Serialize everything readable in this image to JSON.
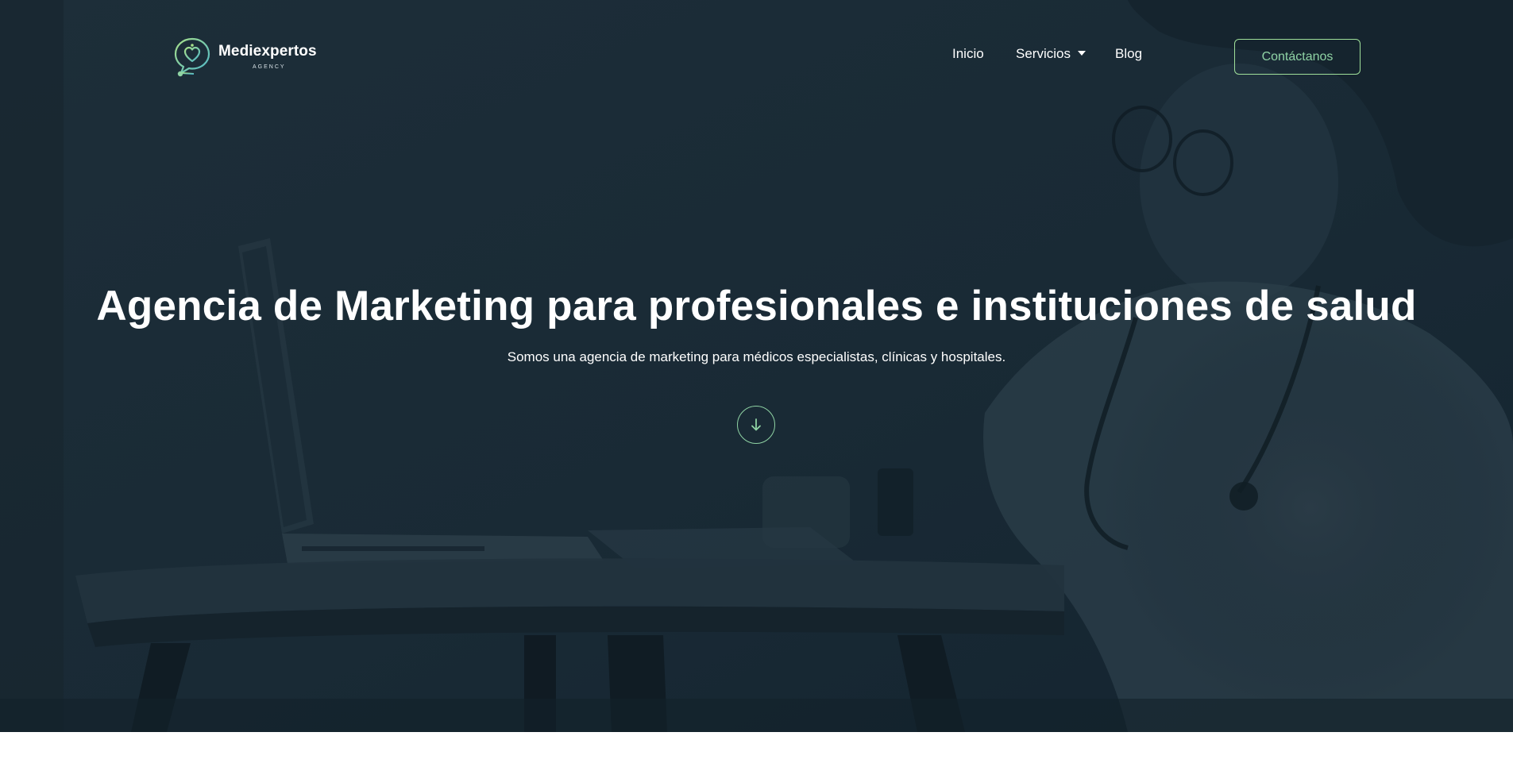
{
  "brand": {
    "name": "Mediexpertos",
    "tagline": "AGENCY",
    "logo_icon": "stethoscope-heart-chat-icon",
    "accent_gradient": [
      "#a7e08a",
      "#4fb7c9"
    ]
  },
  "nav": {
    "items": [
      {
        "label": "Inicio"
      },
      {
        "label": "Servicios",
        "has_dropdown": true
      },
      {
        "label": "Blog"
      }
    ],
    "cta_label": "Contáctanos"
  },
  "hero": {
    "title": "Agencia de Marketing para profesionales e instituciones de salud",
    "subtitle": "Somos una agencia de marketing para médicos especialistas, clínicas y hospitales.",
    "scroll_icon": "arrow-down-icon",
    "background_image": "doctor-at-desk-with-laptop",
    "overlay_color": "#1b2b36"
  },
  "colors": {
    "accent_green": "#9fdf9a",
    "accent_teal": "#8fd3a4",
    "text": "#ffffff"
  }
}
